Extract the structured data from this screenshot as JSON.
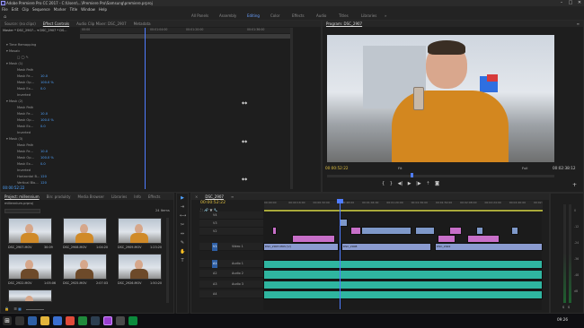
{
  "window": {
    "title": "Adobe Premiere Pro CC 2017 - C:\\Users\\...\\Premiere Pro\\Samsung\\premiere.prproj",
    "minimize": "–",
    "maximize": "□",
    "close": "✕"
  },
  "menu": [
    "File",
    "Edit",
    "Clip",
    "Sequence",
    "Marker",
    "Title",
    "Window",
    "Help"
  ],
  "workspaces": {
    "items": [
      "All Panels",
      "Assembly",
      "Editing",
      "Color",
      "Effects",
      "Audio",
      "Titles",
      "Libraries"
    ],
    "active": "Editing",
    "more": "»"
  },
  "source_panel": {
    "tabs": [
      "Source: (no clips)",
      "Effect Controls",
      "Audio Clip Mixer: DSC_2907",
      "Metadata"
    ],
    "active_tab": "Effect Controls",
    "more": "»",
    "master": "Master * DSC_2907... ▾ DSC_2907 * DS...",
    "ruler_times": [
      "00:00",
      "00:01:04:00",
      "00:01:20:00",
      "00:01:36:00"
    ],
    "rows": [
      {
        "label": "▾ Time Remapping",
        "value": ""
      },
      {
        "label": "▾ Mosaic",
        "value": ""
      },
      {
        "label": "□ ◯ ✎",
        "value": ""
      },
      {
        "label": "▾ Mask (1)",
        "value": ""
      },
      {
        "label": "Mask Path",
        "value": ""
      },
      {
        "label": "Mask Fe...",
        "value": "10.0"
      },
      {
        "label": "Mask Op...",
        "value": "100.0 %"
      },
      {
        "label": "Mask Ex...",
        "value": "0.0"
      },
      {
        "label": "Inverted",
        "value": ""
      },
      {
        "label": "▾ Mask (2)",
        "value": ""
      },
      {
        "label": "Mask Path",
        "value": ""
      },
      {
        "label": "Mask Fe...",
        "value": "10.0"
      },
      {
        "label": "Mask Op...",
        "value": "100.0 %"
      },
      {
        "label": "Mask Ex...",
        "value": "0.0"
      },
      {
        "label": "Inverted",
        "value": ""
      },
      {
        "label": "▾ Mask (3)",
        "value": ""
      },
      {
        "label": "Mask Path",
        "value": ""
      },
      {
        "label": "Mask Fe...",
        "value": "10.0"
      },
      {
        "label": "Mask Op...",
        "value": "100.0 %"
      },
      {
        "label": "Mask Ex...",
        "value": "0.0"
      },
      {
        "label": "Inverted",
        "value": ""
      },
      {
        "label": "Horizontal B...",
        "value": "120"
      },
      {
        "label": "Vertical Blo...",
        "value": "120"
      }
    ],
    "timecode": "00:00:52:22"
  },
  "program_monitor": {
    "title": "Program: DSC_2907",
    "menu_icon": "≡",
    "timecode": "00:00:52:22",
    "fit": "Fit",
    "quality": "Full",
    "duration": "00:02:38:12"
  },
  "project_panel": {
    "tabs": [
      "Project: millennium",
      "Bin: produkty",
      "Media Browser",
      "Libraries",
      "Info",
      "Effects"
    ],
    "active_tab": "Project: millennium",
    "more": "»",
    "project_file": "millennium.prproj",
    "item_count": "24 Items",
    "clips": [
      {
        "name": "DSC_2907.MOV",
        "duration": "30:09"
      },
      {
        "name": "DSC_2908.MOV",
        "duration": "1:04:20"
      },
      {
        "name": "DSC_2909.MOV",
        "duration": "1:23:20"
      },
      {
        "name": "DSC_2922.MOV",
        "duration": "1:05:06"
      },
      {
        "name": "DSC_2925.MOV",
        "duration": "2:07:03"
      },
      {
        "name": "DSC_2926.MOV",
        "duration": "1:50:20"
      }
    ]
  },
  "tools": [
    "▶",
    "⇥",
    "⟷",
    "✂",
    "⇔",
    "✎",
    "✋",
    "T"
  ],
  "timeline": {
    "sequence_tab": "DSC_2907",
    "close": "×",
    "menu_icon": "≡",
    "timecode": "00:00:52:22",
    "ruler": [
      "00:00:00",
      "00:00:16:00",
      "00:00:32:00",
      "00:00:48:00",
      "00:01:04:00",
      "00:01:20:00",
      "00:01:36:00",
      "00:01:52:00",
      "00:02:08:00",
      "00:02:24:00",
      "00:02:40:00",
      "00:02:56:00"
    ],
    "tracks": [
      {
        "id": "V4",
        "name": ""
      },
      {
        "id": "V3",
        "name": ""
      },
      {
        "id": "V2",
        "name": ""
      },
      {
        "id": "V1",
        "name": "Video 1"
      },
      {
        "id": "A1",
        "name": "Audio 1"
      },
      {
        "id": "A2",
        "name": "Audio 2"
      },
      {
        "id": "A3",
        "name": "Audio 3"
      },
      {
        "id": "A4",
        "name": ""
      }
    ],
    "clip_labels": [
      "DSC_2907.MOV [V]",
      "DSC_2908",
      "DSC_2922",
      "DSC_2907"
    ]
  },
  "audio_meter": {
    "scale": [
      "0",
      "-12",
      "-24",
      "-36",
      "-48",
      "dB"
    ],
    "solo": "S"
  },
  "taskbar": {
    "time": "09:26",
    "date": ""
  },
  "colors": {
    "accent": "#4fa3ff",
    "video_clip": "#8a9bd0",
    "audio_clip": "#2fb5a0",
    "playhead": "#4f7cff"
  }
}
